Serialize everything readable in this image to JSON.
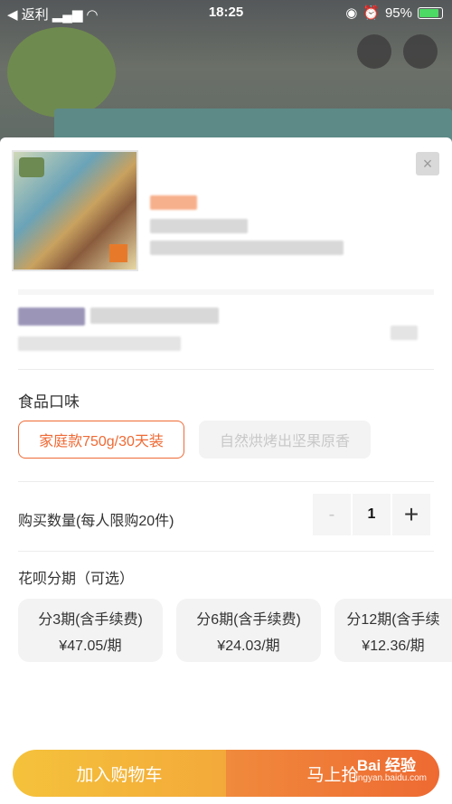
{
  "status_bar": {
    "back_label": "◀ 返利",
    "time": "18:25",
    "battery": "95%"
  },
  "sheet": {
    "close_label": "×",
    "flavor": {
      "title": "食品口味",
      "options": [
        {
          "label": "家庭款750g/30天装",
          "state": "selected"
        },
        {
          "label": "自然烘烤出坚果原香",
          "state": "disabled"
        }
      ]
    },
    "quantity": {
      "title": "购买数量(每人限购20件)",
      "minus_label": "-",
      "value": "1",
      "plus_label": "+"
    },
    "installment": {
      "title": "花呗分期（可选）",
      "plans": [
        {
          "period": "分3期(含手续费)",
          "amount": "¥47.05/期"
        },
        {
          "period": "分6期(含手续费)",
          "amount": "¥24.03/期"
        },
        {
          "period": "分12期(含手续",
          "amount": "¥12.36/期"
        }
      ]
    },
    "actions": {
      "cart_label": "加入购物车",
      "buy_label": "马上抢"
    }
  },
  "watermark": {
    "logo": "Bai 经验",
    "url": "jingyan.baidu.com"
  },
  "colors": {
    "accent": "#ef6a35",
    "cart_button": "#f5c23b",
    "buy_button": "#ee6a32"
  }
}
